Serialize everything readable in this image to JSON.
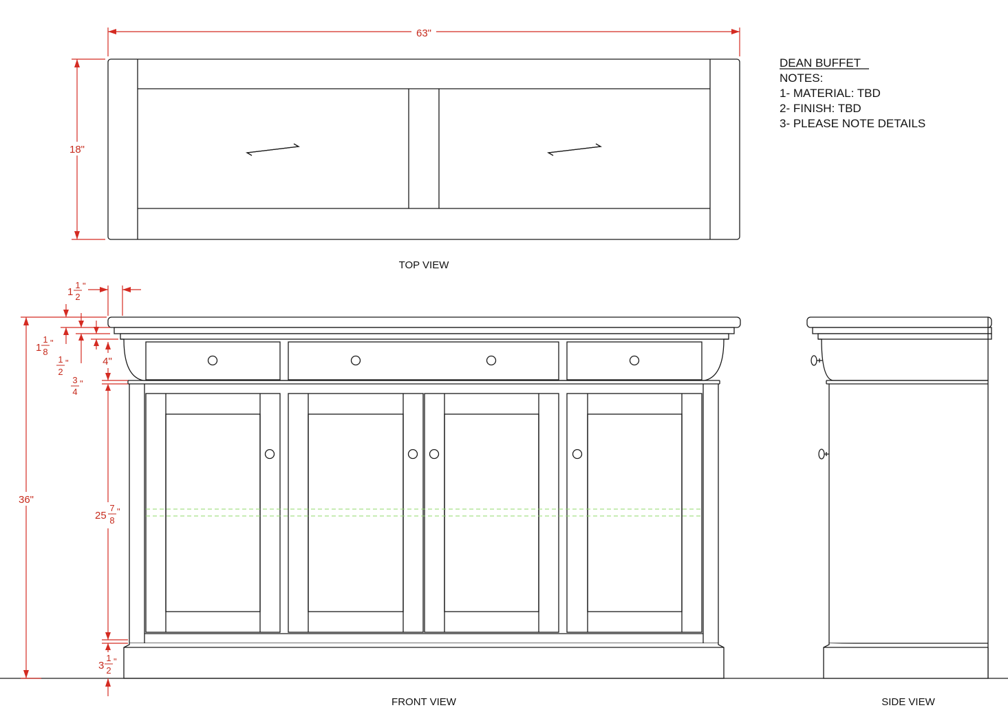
{
  "title": "DEAN  BUFFET",
  "notes": {
    "heading": "NOTES:",
    "items": [
      "1- MATERIAL: TBD",
      "2- FINISH: TBD",
      "3- PLEASE NOTE DETAILS"
    ]
  },
  "views": {
    "top": "TOP VIEW",
    "front": "FRONT VIEW",
    "side": "SIDE VIEW"
  },
  "dimensions": {
    "width": "63\"",
    "depth": "18\"",
    "height": "36\"",
    "top_overhang": {
      "whole": "1",
      "num": "1",
      "den": "2",
      "unit": "\""
    },
    "top_thickness": {
      "whole": "1",
      "num": "1",
      "den": "8",
      "unit": "\""
    },
    "top_step": {
      "whole": "",
      "num": "1",
      "den": "2",
      "unit": "\""
    },
    "drawer_height": "4\"",
    "drawer_gap": {
      "whole": "",
      "num": "3",
      "den": "4",
      "unit": "\""
    },
    "door_height": {
      "whole": "25",
      "num": "7",
      "den": "8",
      "unit": "\""
    },
    "plinth_height": {
      "whole": "3",
      "num": "1",
      "den": "2",
      "unit": "\""
    }
  },
  "colors": {
    "line": "#1a1a1a",
    "dimension": "#d42b22",
    "shelf_hidden": "#8fd86a",
    "background": "#ffffff"
  }
}
